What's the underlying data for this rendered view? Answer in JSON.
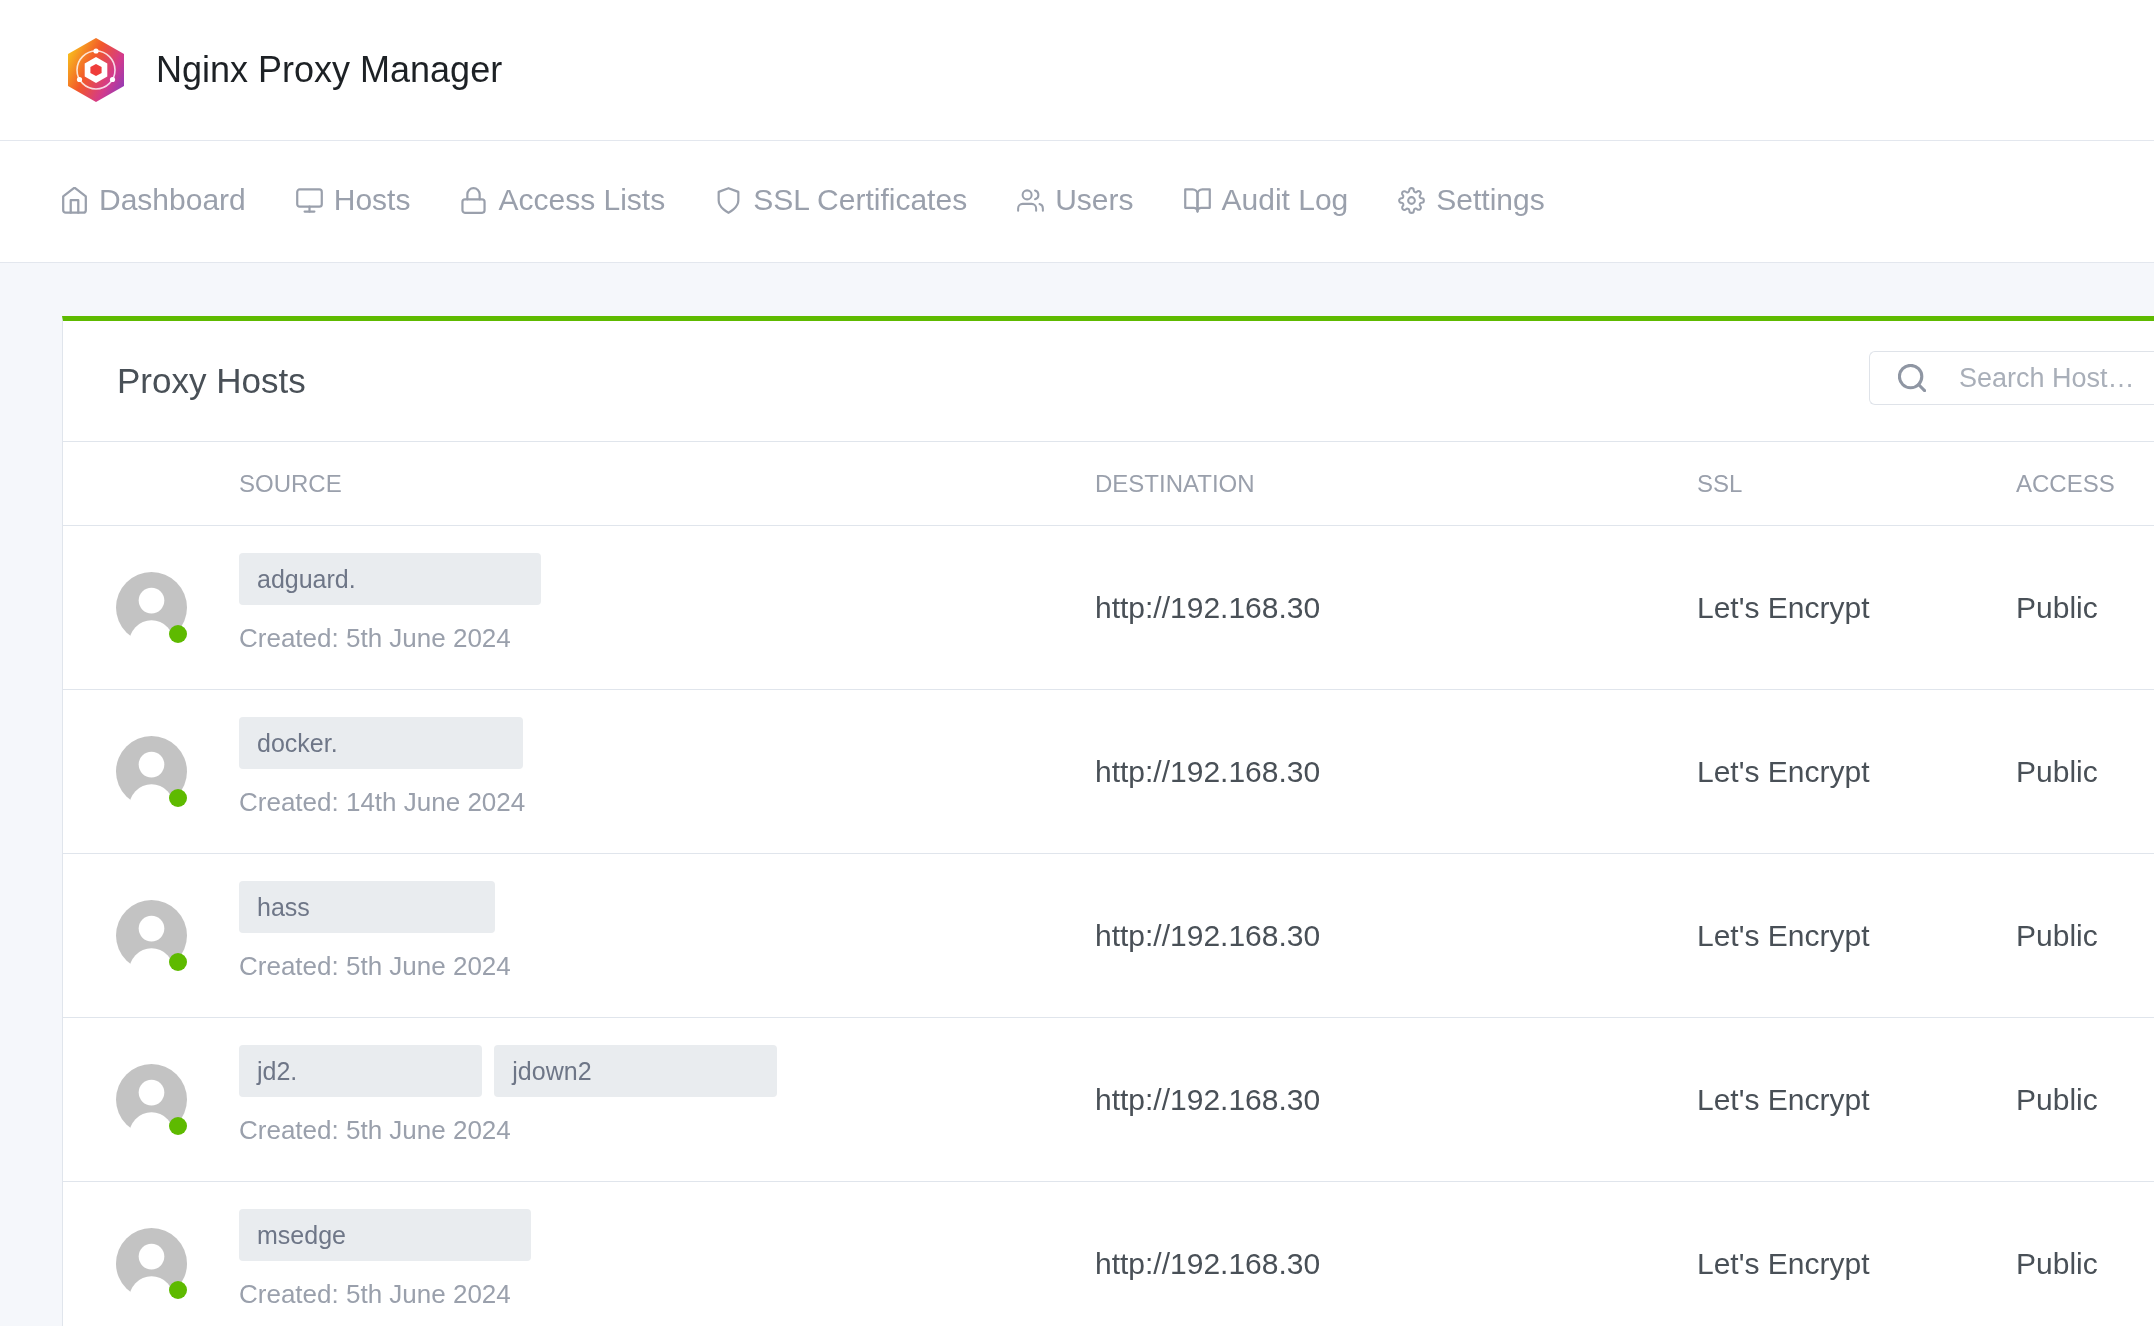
{
  "header": {
    "title": "Nginx Proxy Manager"
  },
  "nav": [
    {
      "kind": "dashboard",
      "label": "Dashboard",
      "selected": false
    },
    {
      "kind": "hosts",
      "label": "Hosts",
      "selected": false
    },
    {
      "kind": "access",
      "label": "Access Lists",
      "selected": false
    },
    {
      "kind": "ssl",
      "label": "SSL Certificates",
      "selected": false
    },
    {
      "kind": "users",
      "label": "Users",
      "selected": false
    },
    {
      "kind": "audit",
      "label": "Audit Log",
      "selected": false
    },
    {
      "kind": "settings",
      "label": "Settings",
      "selected": false
    }
  ],
  "card": {
    "title": "Proxy Hosts",
    "search": {
      "placeholder": "Search Host…"
    },
    "columns": [
      "SOURCE",
      "DESTINATION",
      "SSL",
      "ACCESS"
    ],
    "rows": [
      {
        "domains": [
          "adguard."
        ],
        "created": "Created: 5th June 2024",
        "destination": "http://192.168.30",
        "ssl": "Let's Encrypt",
        "access": "Public",
        "online": true
      },
      {
        "domains": [
          "docker."
        ],
        "created": "Created: 14th June 2024",
        "destination": "http://192.168.30",
        "ssl": "Let's Encrypt",
        "access": "Public",
        "online": true
      },
      {
        "domains": [
          "hass"
        ],
        "created": "Created: 5th June 2024",
        "destination": "http://192.168.30",
        "ssl": "Let's Encrypt",
        "access": "Public",
        "online": true
      },
      {
        "domains": [
          "jd2.",
          "jdown2"
        ],
        "created": "Created: 5th June 2024",
        "destination": "http://192.168.30",
        "ssl": "Let's Encrypt",
        "access": "Public",
        "online": true
      },
      {
        "domains": [
          "msedge"
        ],
        "created": "Created: 5th June 2024",
        "destination": "http://192.168.30",
        "ssl": "Let's Encrypt",
        "access": "Public",
        "online": true
      }
    ]
  }
}
